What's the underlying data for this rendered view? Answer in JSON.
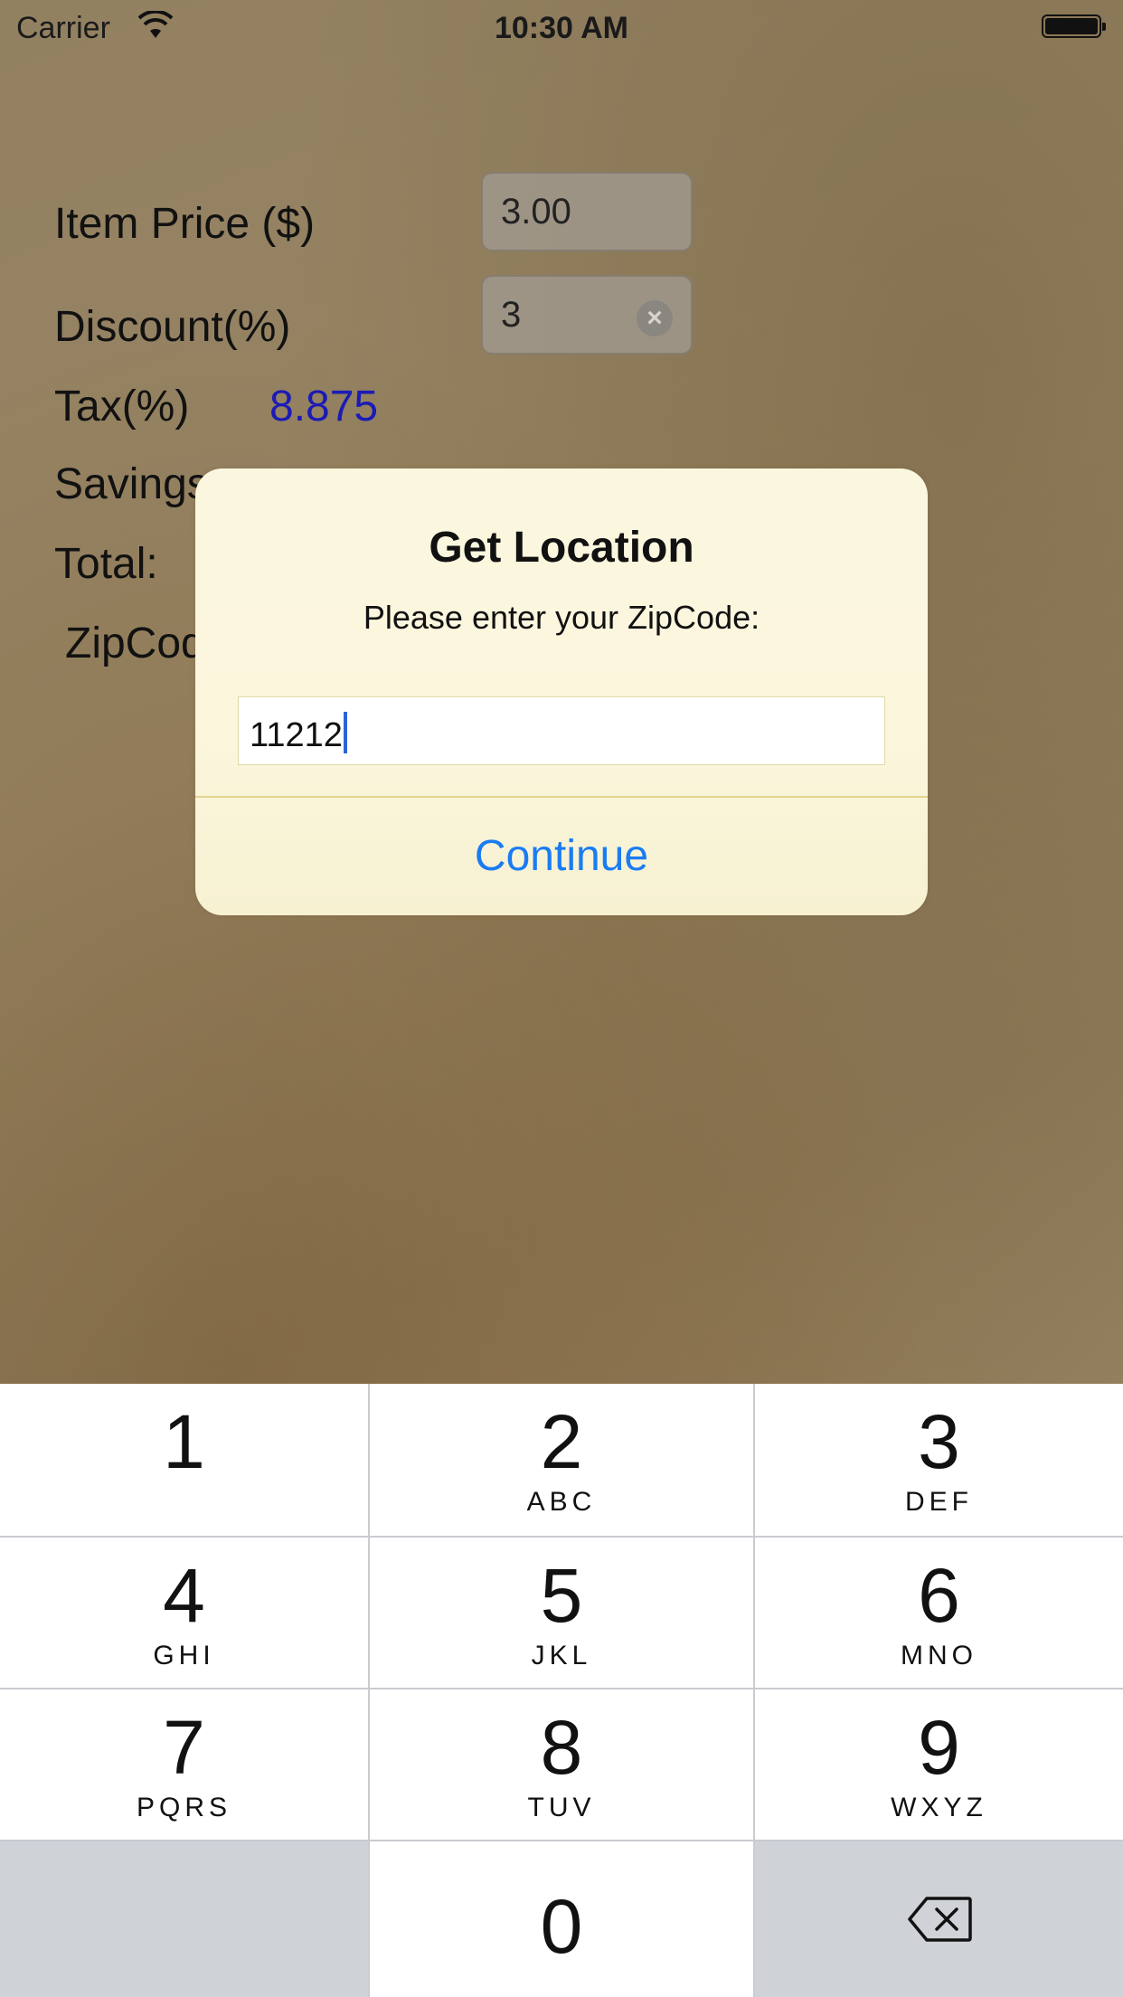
{
  "status_bar": {
    "carrier": "Carrier",
    "time": "10:30 AM"
  },
  "form": {
    "item_price_label": "Item Price ($)",
    "item_price_value": "3.00",
    "discount_label": "Discount(%)",
    "discount_value": "3",
    "tax_label": "Tax(%)",
    "tax_value": "8.875",
    "savings_label": "Savings",
    "total_label": "Total:",
    "zipcode_label": "ZipCod"
  },
  "alert": {
    "title": "Get Location",
    "message": "Please enter your ZipCode:",
    "input_value": "11212",
    "button_label": "Continue"
  },
  "keypad": {
    "keys": [
      {
        "digit": "1",
        "letters": ""
      },
      {
        "digit": "2",
        "letters": "ABC"
      },
      {
        "digit": "3",
        "letters": "DEF"
      },
      {
        "digit": "4",
        "letters": "GHI"
      },
      {
        "digit": "5",
        "letters": "JKL"
      },
      {
        "digit": "6",
        "letters": "MNO"
      },
      {
        "digit": "7",
        "letters": "PQRS"
      },
      {
        "digit": "8",
        "letters": "TUV"
      },
      {
        "digit": "9",
        "letters": "WXYZ"
      },
      {
        "digit": "0",
        "letters": ""
      }
    ],
    "delete_icon": "backspace-icon"
  }
}
